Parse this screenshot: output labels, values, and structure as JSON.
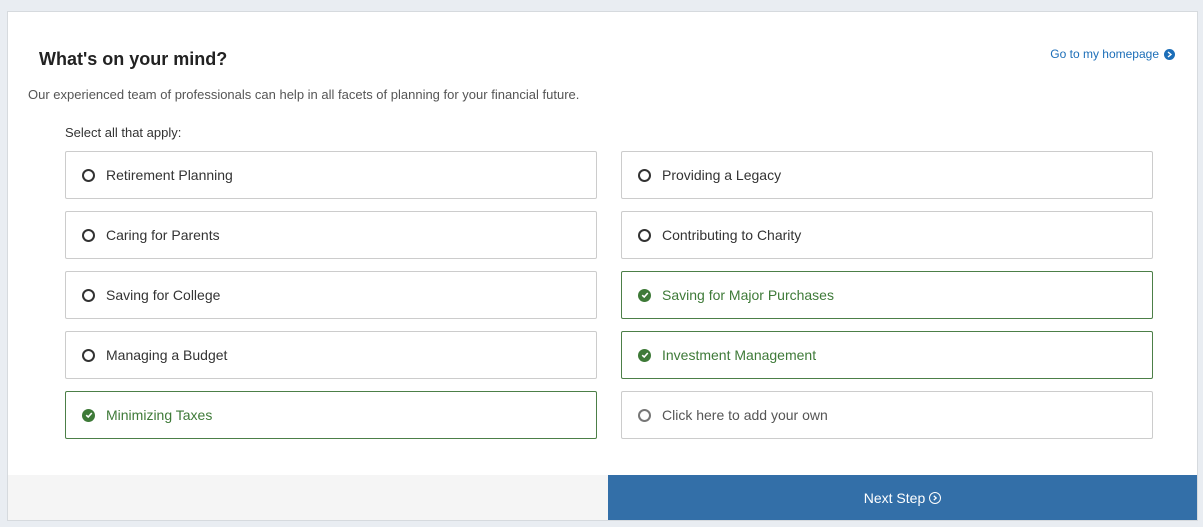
{
  "header": {
    "title": "What's on your mind?",
    "home_link": "Go to my homepage",
    "subtitle": "Our experienced team of professionals can help in all facets of planning for your financial future."
  },
  "form": {
    "select_label": "Select all that apply:",
    "options": [
      {
        "label": "Retirement Planning",
        "selected": false
      },
      {
        "label": "Providing a Legacy",
        "selected": false
      },
      {
        "label": "Caring for Parents",
        "selected": false
      },
      {
        "label": "Contributing to Charity",
        "selected": false
      },
      {
        "label": "Saving for College",
        "selected": false
      },
      {
        "label": "Saving for Major Purchases",
        "selected": true
      },
      {
        "label": "Managing a Budget",
        "selected": false
      },
      {
        "label": "Investment Management",
        "selected": true
      },
      {
        "label": "Minimizing Taxes",
        "selected": true
      },
      {
        "label": "Click here to add your own",
        "selected": false,
        "placeholder": true
      }
    ]
  },
  "footer": {
    "next_label": "Next Step"
  },
  "colors": {
    "link": "#1c6eb8",
    "selected": "#3e7a38",
    "primary_button": "#336fa8",
    "page_background": "#e9edf2"
  },
  "icons": {
    "unselected": "circle-outline-icon",
    "selected": "check-circle-icon",
    "home_link": "arrow-circle-right-icon",
    "next": "arrow-circle-right-icon"
  }
}
